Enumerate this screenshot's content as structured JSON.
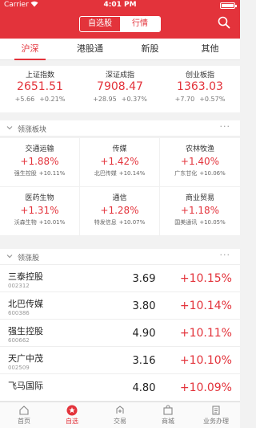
{
  "status_bar": {
    "carrier": "Carrier",
    "time": "4:01 PM"
  },
  "header": {
    "segments": [
      {
        "label": "自选股",
        "active": false
      },
      {
        "label": "行情",
        "active": true
      }
    ]
  },
  "market_tabs": [
    {
      "label": "沪深",
      "active": true
    },
    {
      "label": "港股通",
      "active": false
    },
    {
      "label": "新股",
      "active": false
    },
    {
      "label": "其他",
      "active": false
    }
  ],
  "indices": [
    {
      "name": "上证指数",
      "value": "2651.51",
      "change": "+5.66",
      "percent": "+0.21%"
    },
    {
      "name": "深证成指",
      "value": "7908.47",
      "change": "+28.95",
      "percent": "+0.37%"
    },
    {
      "name": "创业板指",
      "value": "1363.03",
      "change": "+7.70",
      "percent": "+0.57%"
    }
  ],
  "sector_section": {
    "title": "领涨板块",
    "more": "···"
  },
  "sectors": [
    {
      "name": "交通运输",
      "percent": "+1.88%",
      "leader": "强生控股",
      "leader_percent": "+10.11%"
    },
    {
      "name": "传媒",
      "percent": "+1.42%",
      "leader": "北巴传媒",
      "leader_percent": "+10.14%"
    },
    {
      "name": "农林牧渔",
      "percent": "+1.40%",
      "leader": "广东甘化",
      "leader_percent": "+10.06%"
    },
    {
      "name": "医药生物",
      "percent": "+1.31%",
      "leader": "沃森生物",
      "leader_percent": "+10.01%"
    },
    {
      "name": "通信",
      "percent": "+1.28%",
      "leader": "特发信息",
      "leader_percent": "+10.07%"
    },
    {
      "name": "商业贸易",
      "percent": "+1.18%",
      "leader": "国美通讯",
      "leader_percent": "+10.05%"
    }
  ],
  "stock_section": {
    "title": "领涨股",
    "more": "···"
  },
  "stocks": [
    {
      "name": "三泰控股",
      "code": "002312",
      "price": "3.69",
      "change": "+10.15%"
    },
    {
      "name": "北巴传媒",
      "code": "600386",
      "price": "3.80",
      "change": "+10.14%"
    },
    {
      "name": "强生控股",
      "code": "600662",
      "price": "4.90",
      "change": "+10.11%"
    },
    {
      "name": "天广中茂",
      "code": "002509",
      "price": "3.16",
      "change": "+10.10%"
    },
    {
      "name": "飞马国际",
      "code": "",
      "price": "4.80",
      "change": "+10.09%"
    }
  ],
  "bottom_nav": [
    {
      "label": "首页",
      "icon": "home-icon",
      "active": false
    },
    {
      "label": "自选",
      "icon": "star-icon",
      "active": true
    },
    {
      "label": "交易",
      "icon": "trade-icon",
      "active": false
    },
    {
      "label": "商城",
      "icon": "mall-icon",
      "active": false
    },
    {
      "label": "业务办理",
      "icon": "business-icon",
      "active": false
    }
  ],
  "colors": {
    "brand": "#e3333b",
    "up": "#e3333b"
  }
}
